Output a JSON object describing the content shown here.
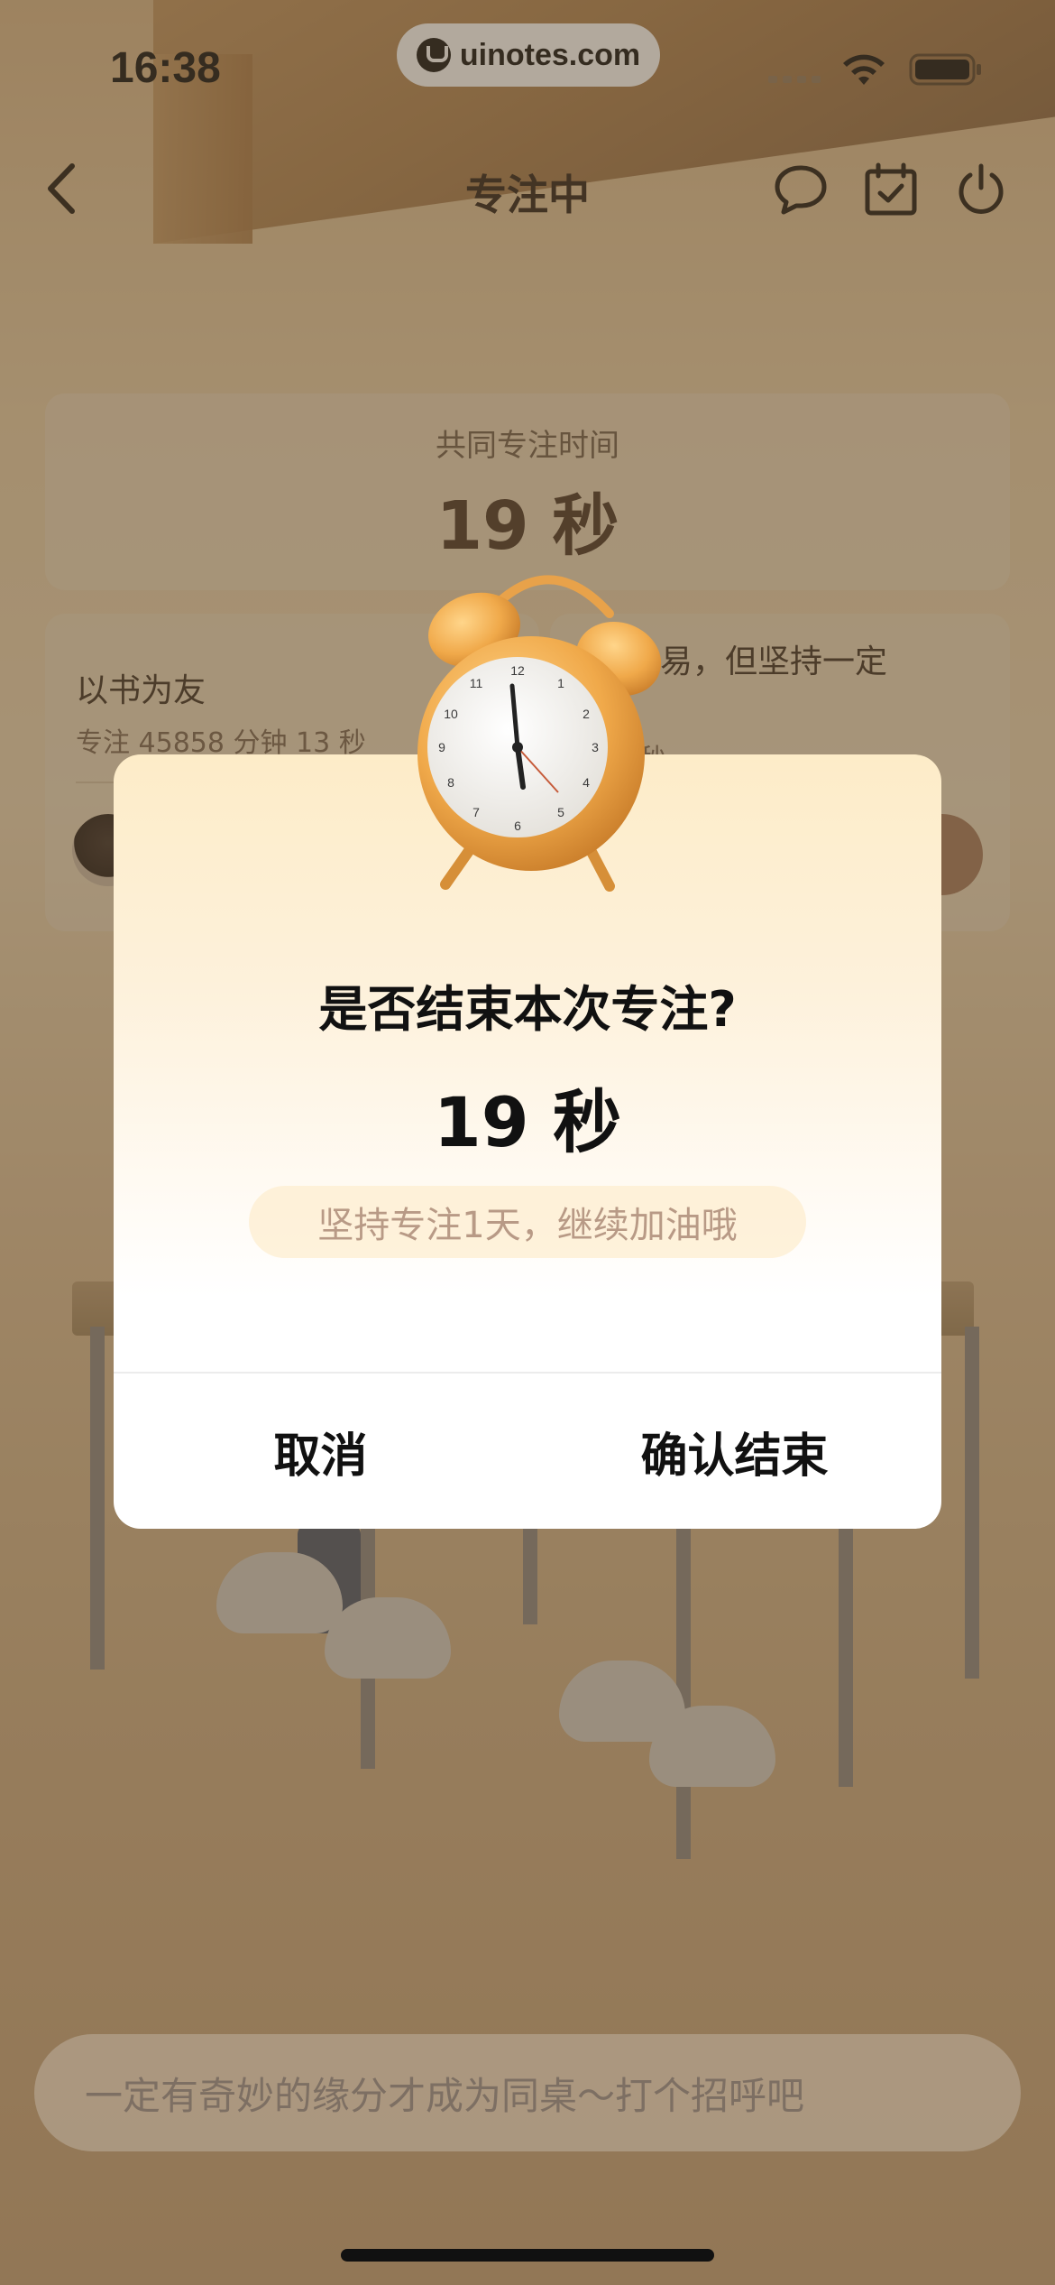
{
  "status_bar": {
    "time": "16:38",
    "url": "uinotes.com",
    "icons": [
      "signal-icon",
      "wifi-icon",
      "battery-icon"
    ]
  },
  "nav": {
    "title": "专注中",
    "icons": [
      "back-chevron-icon",
      "chat-bubble-icon",
      "calendar-check-icon",
      "power-icon"
    ]
  },
  "focus_card": {
    "label": "共同专注时间",
    "value": "19 秒"
  },
  "partner": {
    "name": "以书为友",
    "stat": "专注 45858 分钟 13 秒"
  },
  "partner_right": {
    "quote": "很容易，但坚持一定",
    "quote_line2": "！",
    "stat_partial": "0 秒"
  },
  "dialog": {
    "title": "是否结束本次专注?",
    "duration": "19 秒",
    "encourage": "坚持专注1天，继续加油哦",
    "cancel_label": "取消",
    "confirm_label": "确认结束"
  },
  "bottom": {
    "placeholder": "一定有奇妙的缘分才成为同桌～打个招呼吧"
  },
  "colors": {
    "dialog_top": "#fdecc8",
    "encourage_text": "#b89a86",
    "accent_brown": "#4a3525"
  }
}
